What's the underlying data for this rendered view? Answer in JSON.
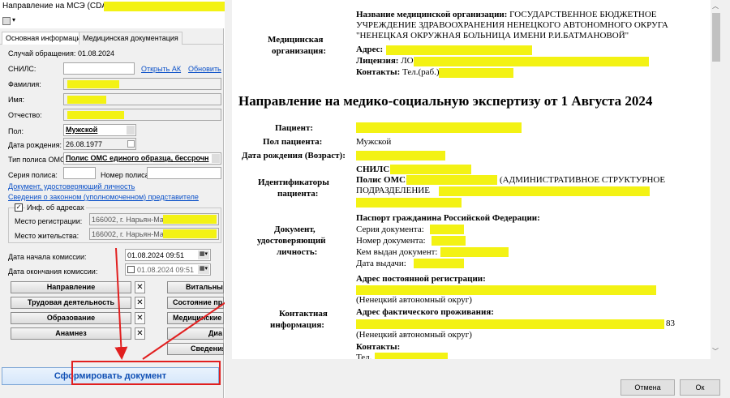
{
  "left": {
    "title": "Направление на МСЭ (CDA)",
    "tabs": [
      "Основная информация",
      "Медицинская документация"
    ],
    "case_label": "Случай обращения:",
    "case_value": "01.08.2024",
    "snils_label": "СНИЛС:",
    "open_ak": "Открыть АК",
    "refresh": "Обновить",
    "surname_label": "Фамилия:",
    "name_label": "Имя:",
    "patronymic_label": "Отчество:",
    "sex_label": "Пол:",
    "sex_value": "Мужской",
    "birth_label": "Дата рождения:",
    "birth_value": "26.08.1977",
    "policy_type_label": "Тип полиса ОМС:",
    "policy_type_value": "Полис ОМС единого образца, бессрочн",
    "policy_series_label": "Серия полиса:",
    "policy_number_label": "Номер полиса:",
    "doc_link": "Документ, удостоверяющий личность",
    "rep_link": "Сведения о законном (уполномоченном) представителе",
    "addr_group": "Инф. об адресах",
    "reg_label": "Место регистрации:",
    "reg_value": "166002, г. Нарьян-Мар,",
    "live_label": "Место жительства:",
    "live_value": "166002, г. Нарьян-Мар,",
    "comm_start_label": "Дата начала комиссии:",
    "comm_start_value": "01.08.2024 09:51",
    "comm_end_label": "Дата окончания комиссии:",
    "comm_end_value": "01.08.2024 09:51",
    "buttons_left": [
      "Направление",
      "Трудовая деятельность",
      "Образование",
      "Анамнез"
    ],
    "buttons_right": [
      "Витальны",
      "Состояние пр",
      "Медицинские",
      "Диа",
      "Сведения"
    ],
    "x_symbol": "✕",
    "form_button": "Сформировать документ"
  },
  "doc": {
    "org_section": "Медицинская организация:",
    "org_name_label": "Название медицинской организации:",
    "org_name_l1": "ГОСУДАРСТВЕННОЕ БЮДЖЕТНОЕ",
    "org_name_l2": "УЧРЕЖДЕНИЕ ЗДРАВООХРАНЕНИЯ НЕНЕЦКОГО АВТОНОМНОГО ОКРУГА",
    "org_name_l3": "\"НЕНЕЦКАЯ ОКРУЖНАЯ БОЛЬНИЦА ИМЕНИ Р.И.БАТМАНОВОЙ\"",
    "address_label": "Адрес:",
    "license_label": "Лицензия:",
    "license_value": "ЛО",
    "contacts_label": "Контакты:",
    "contacts_value": "Тел.(раб.)",
    "heading": "Направление на медико-социальную экспертизу от 1 Августа 2024",
    "patient_label": "Пациент:",
    "sex_label": "Пол пациента:",
    "sex_value": "Мужской",
    "birth_label": "Дата рождения (Возраст):",
    "ids_section_l1": "Идентификаторы",
    "ids_section_l2": "пациента:",
    "snils_label": "СНИЛС:",
    "oms_label": "Полис ОМС:",
    "oms_value_l1": "(АДМИНИСТРАТИВНОЕ СТРУКТУРНОЕ",
    "oms_value_l2": "ПОДРАЗДЕЛЕНИЕ",
    "iddoc_section_l1": "Документ,",
    "iddoc_section_l2": "удостоверяющий",
    "iddoc_section_l3": "личность:",
    "passport_title": "Паспорт гражданина Российской Федерации:",
    "series_label": "Серия документа:",
    "number_label": "Номер документа:",
    "issued_by_label": "Кем выдан документ:",
    "issue_date_label": "Дата выдачи:",
    "contact_section_l1": "Контактная",
    "contact_section_l2": "информация:",
    "perm_addr_label": "Адрес постоянной регистрации:",
    "region_line": "(Ненецкий автономный округ)",
    "actual_addr_label": "Адрес фактического проживания:",
    "actual_addr_tail": "83",
    "region_line2": "(Ненецкий автономный округ)",
    "contacts2_label": "Контакты:",
    "tel_label": "Тел."
  },
  "dialog": {
    "cancel": "Отмена",
    "ok": "Ок"
  },
  "colors": {
    "highlight": "#f3f214",
    "arrow": "#e11f1f",
    "link": "#0a50c8"
  }
}
